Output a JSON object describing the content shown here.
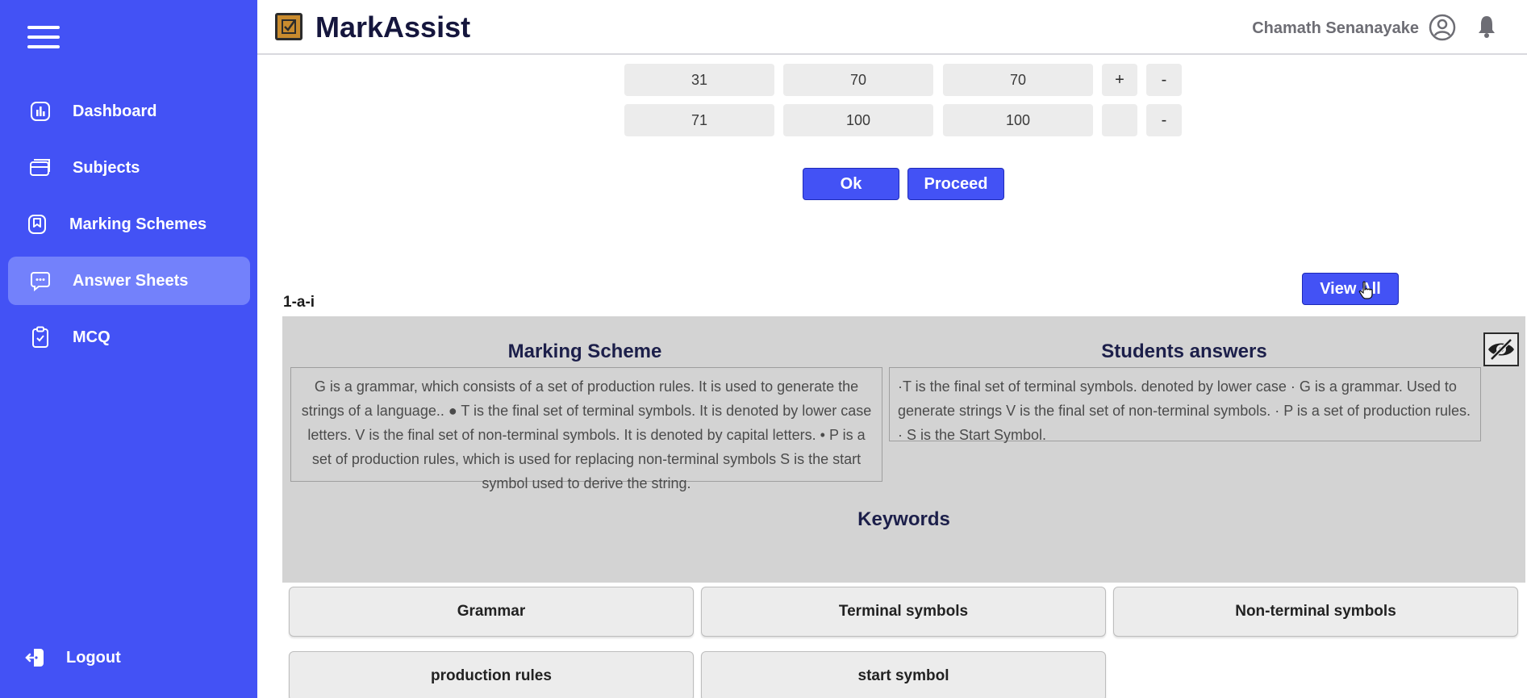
{
  "app": {
    "brand": "MarkAssist",
    "user_name": "Chamath Senanayake"
  },
  "sidebar": {
    "items": [
      {
        "label": "Dashboard",
        "icon": "dashboard-chart-icon"
      },
      {
        "label": "Subjects",
        "icon": "subjects-card-icon"
      },
      {
        "label": "Marking Schemes",
        "icon": "bookmark-icon"
      },
      {
        "label": "Answer Sheets",
        "icon": "chat-bubble-icon",
        "active": true
      },
      {
        "label": "MCQ",
        "icon": "clipboard-icon"
      }
    ],
    "logout_label": "Logout"
  },
  "grade_ranges": [
    {
      "from": "31",
      "to": "70",
      "value": "70",
      "add": "+",
      "remove": "-"
    },
    {
      "from": "71",
      "to": "100",
      "value": "100",
      "add": "",
      "remove": "-"
    }
  ],
  "actions": {
    "ok_label": "Ok",
    "proceed_label": "Proceed",
    "view_all_label": "View All"
  },
  "question": {
    "id": "1-a-i",
    "marking_scheme_title": "Marking Scheme",
    "marking_scheme_text": "G is a grammar, which consists of a set of production rules. It is used to generate the strings of a language.. ● T is the final set of terminal symbols. It is denoted by lower case letters. V is the final set of non-terminal symbols. It is denoted by capital letters. • P is a set of production rules, which is used for replacing non-terminal symbols S is the start symbol used to derive the string.",
    "students_answers_title": "Students answers",
    "students_answer_text": "·T is the final set of terminal symbols. denoted by lower case · G is a grammar. Used to generate strings V is the final set of non-terminal symbols. · P is a set of production rules. · S is the Start Symbol.",
    "keywords_title": "Keywords",
    "keywords": [
      "Grammar",
      "Terminal symbols",
      "Non-terminal symbols",
      "production rules",
      "start symbol"
    ]
  },
  "colors": {
    "sidebar": "#4352f5",
    "active_item": "#7381fb",
    "panel": "#d3d3d3"
  }
}
